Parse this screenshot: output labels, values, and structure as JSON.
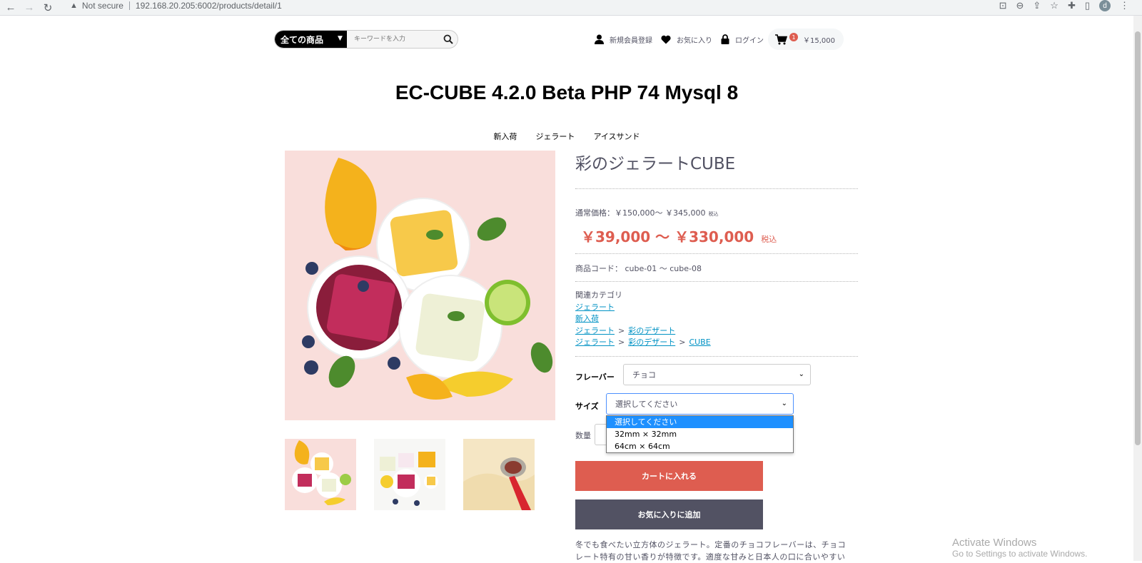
{
  "browser": {
    "not_secure": "Not secure",
    "url": "192.168.20.205:6002/products/detail/1",
    "profile_initial": "d"
  },
  "header": {
    "category_select": "全ての商品",
    "search_placeholder": "キーワードを入力",
    "signup": "新規会員登録",
    "favorites": "お気に入り",
    "login": "ログイン",
    "cart_count": "1",
    "cart_total": "￥15,000"
  },
  "site_title": "EC-CUBE 4.2.0 Beta PHP 74 Mysql 8",
  "nav": [
    "新入荷",
    "ジェラート",
    "アイスサンド"
  ],
  "product": {
    "name": "彩のジェラートCUBE",
    "normal_price": "通常価格：￥150,000～ ￥345,000",
    "normal_tax": "税込",
    "sale_price": "￥39,000 ～ ￥330,000",
    "sale_tax": "税込",
    "code": "商品コード： cube-01 ～ cube-08",
    "category_heading": "関連カテゴリ",
    "categories": {
      "c1": "ジェラート",
      "c2": "新入荷",
      "c3a": "ジェラート",
      "c3b": "彩のデザート",
      "c4a": "ジェラート",
      "c4b": "彩のデザート",
      "c4c": "CUBE",
      "sep": ">"
    },
    "flavor_label": "フレーバー",
    "flavor_value": "チョコ",
    "size_label": "サイズ",
    "size_value": "選択してください",
    "size_options": [
      "選択してください",
      "32mm × 32mm",
      "64cm × 64cm"
    ],
    "qty_label": "数量",
    "add_to_cart": "カートに入れる",
    "add_to_favorites": "お気に入りに追加",
    "description_line1": "冬でも食べたい立方体のジェラート。定番のチョコフレーバーは、チョコ",
    "description_line2": "レート特有の甘い香りが特徴です。適度な甘みと日本人の口に合いやすい"
  },
  "watermark": {
    "line1": "Activate Windows",
    "line2": "Go to Settings to activate Windows."
  },
  "colors": {
    "accent": "#de5d50",
    "dark_button": "#525263",
    "link": "#0092c4",
    "dropdown_selected": "#1e90ff"
  }
}
